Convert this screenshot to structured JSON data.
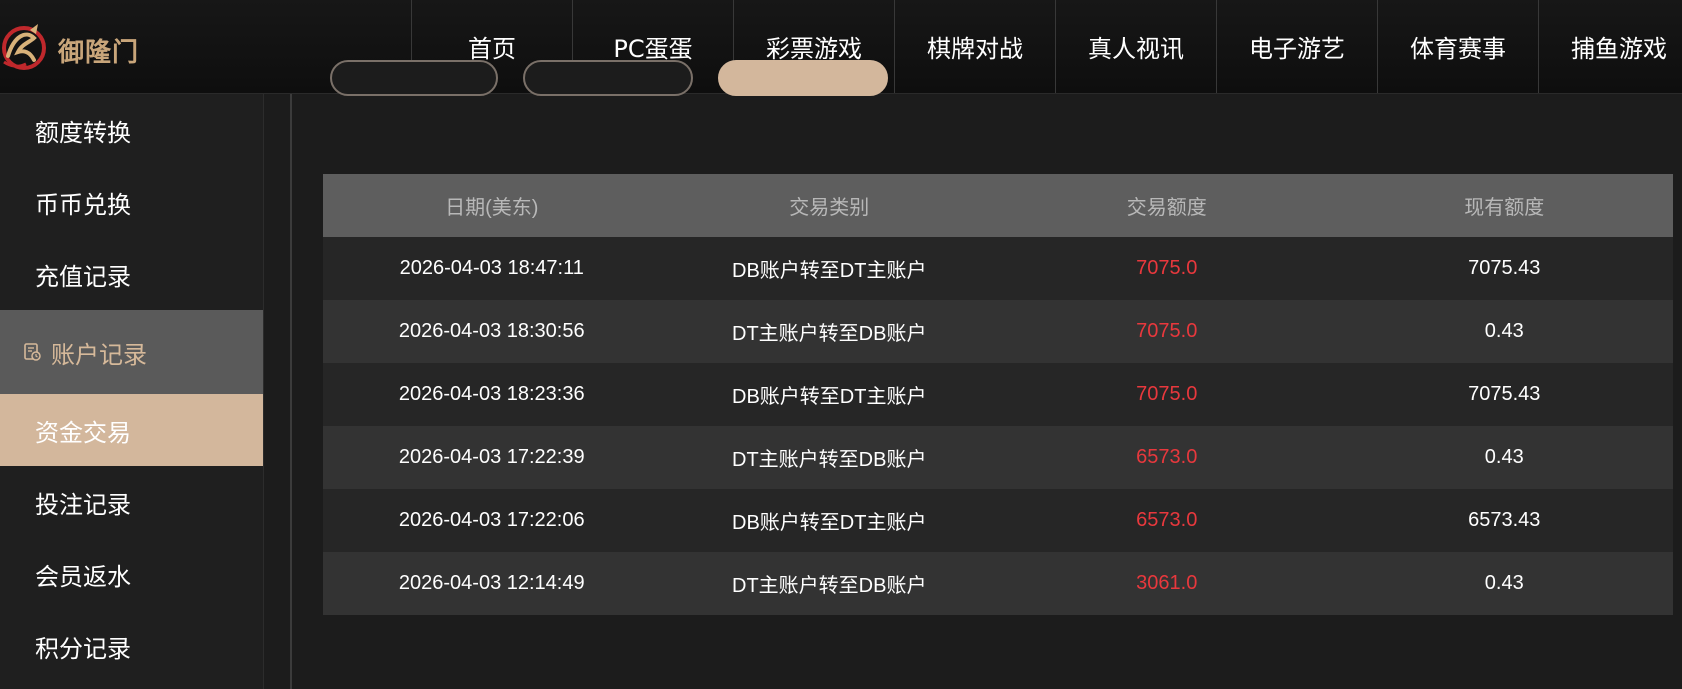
{
  "brand": {
    "name": "御隆门",
    "tagline": "",
    "color": "#c8a57a"
  },
  "nav": {
    "items": [
      "首页",
      "PC蛋蛋",
      "彩票游戏",
      "棋牌对战",
      "真人视讯",
      "电子游艺",
      "体育赛事",
      "捕鱼游戏"
    ]
  },
  "sidebar": {
    "items": [
      {
        "label": "额度转换"
      },
      {
        "label": "币币兑换"
      },
      {
        "label": "充值记录"
      },
      {
        "label": "账户记录",
        "icon": "record-icon",
        "group": true
      },
      {
        "label": "资金交易",
        "active": true
      },
      {
        "label": "投注记录"
      },
      {
        "label": "会员返水"
      },
      {
        "label": "积分记录"
      }
    ]
  },
  "table": {
    "headers": [
      "日期(美东)",
      "交易类别",
      "交易额度",
      "现有额度"
    ],
    "rows": [
      [
        "2026-04-03 18:47:11",
        "DB账户转至DT主账户",
        "7075.0",
        "7075.43"
      ],
      [
        "2026-04-03 18:30:56",
        "DT主账户转至DB账户",
        "7075.0",
        "0.43"
      ],
      [
        "2026-04-03 18:23:36",
        "DB账户转至DT主账户",
        "7075.0",
        "7075.43"
      ],
      [
        "2026-04-03 17:22:39",
        "DT主账户转至DB账户",
        "6573.0",
        "0.43"
      ],
      [
        "2026-04-03 17:22:06",
        "DB账户转至DT主账户",
        "6573.0",
        "6573.43"
      ],
      [
        "2026-04-03 12:14:49",
        "DT主账户转至DB账户",
        "3061.0",
        "0.43"
      ]
    ]
  },
  "colors": {
    "accent": "#d3b79c",
    "amount": "#e8383d",
    "header_row": "#5e5e5e"
  }
}
